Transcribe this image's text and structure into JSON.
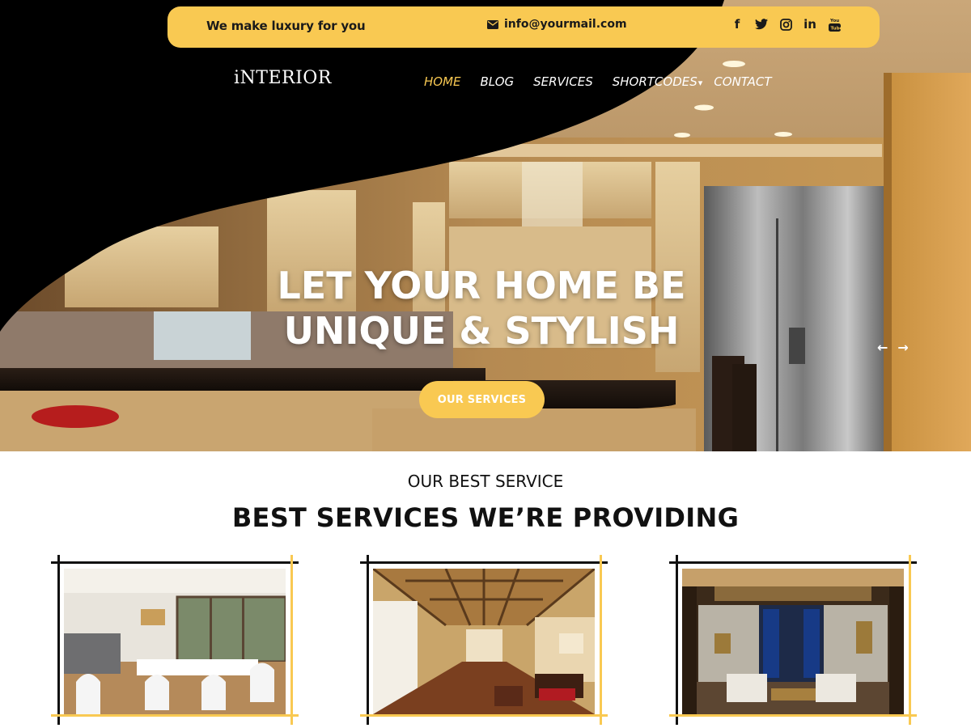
{
  "topbar": {
    "tagline": "We make luxury for you",
    "email": "info@yourmail.com",
    "socials": [
      {
        "icon": "facebook-icon",
        "glyph": "f"
      },
      {
        "icon": "twitter-icon",
        "glyph": "t"
      },
      {
        "icon": "instagram-icon",
        "glyph": "◎"
      },
      {
        "icon": "linkedin-icon",
        "glyph": "in"
      },
      {
        "icon": "youtube-icon",
        "glyph": "▶"
      }
    ]
  },
  "logo": "iNTERIOR",
  "nav": {
    "home": "HOME",
    "blog": "BLOG",
    "services": "SERVICES",
    "shortcodes": "SHORTCODES",
    "shortcodes_caret": "▾",
    "contact": "CONTACT"
  },
  "hero": {
    "title_line1": "LET YOUR HOME BE",
    "title_line2": "UNIQUE & STYLISH",
    "button": "OUR SERVICES",
    "prev_arrow": "←",
    "next_arrow": "→"
  },
  "services": {
    "eyebrow": "OUR BEST SERVICE",
    "title": "BEST SERVICES WE’RE PROVIDING",
    "cards": [
      {
        "image": "dining-room-photo"
      },
      {
        "image": "hallway-photo"
      },
      {
        "image": "living-room-photo"
      }
    ]
  },
  "colors": {
    "accent": "#f9c952",
    "dark": "#000000",
    "text": "#111111"
  }
}
